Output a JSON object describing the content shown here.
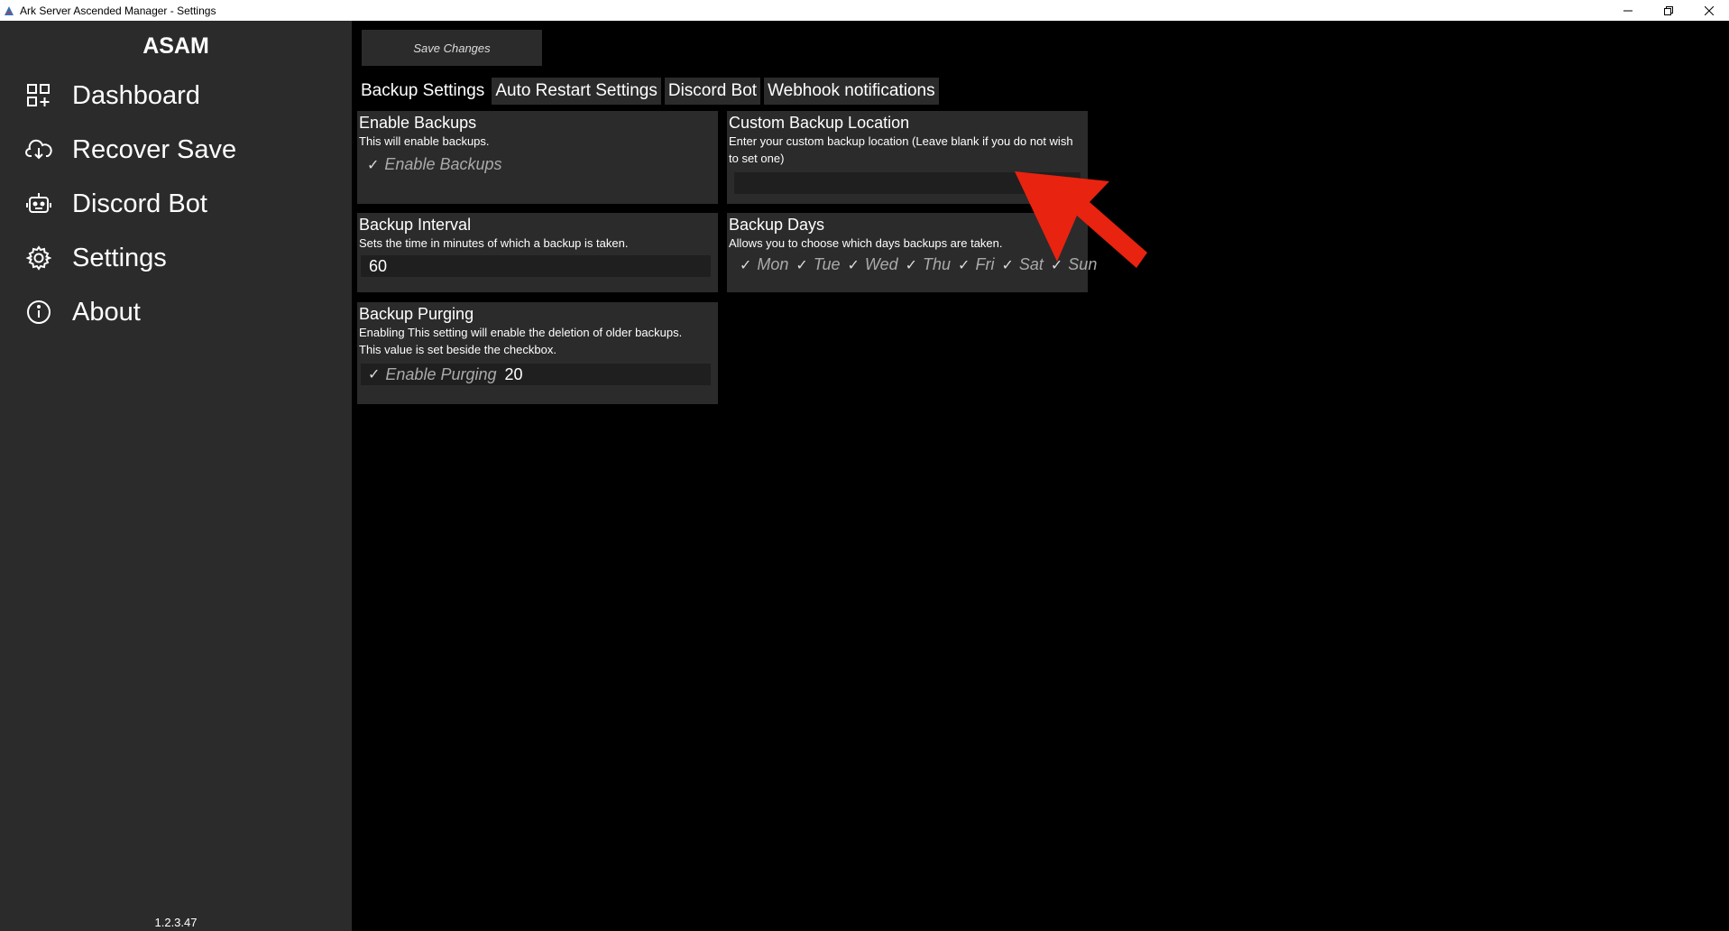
{
  "window": {
    "title": "Ark Server Ascended Manager - Settings",
    "minimize_icon": "minimize-icon",
    "restore_icon": "restore-icon",
    "close_icon": "close-icon"
  },
  "sidebar": {
    "brand": "ASAM",
    "items": [
      {
        "label": "Dashboard",
        "icon": "dashboard-grid-icon"
      },
      {
        "label": "Recover Save",
        "icon": "cloud-download-icon"
      },
      {
        "label": "Discord Bot",
        "icon": "bot-icon"
      },
      {
        "label": "Settings",
        "icon": "gear-icon"
      },
      {
        "label": "About",
        "icon": "info-icon"
      }
    ],
    "version": "1.2.3.47"
  },
  "toolbar": {
    "save_label": "Save Changes"
  },
  "tabs": [
    {
      "label": "Backup Settings",
      "active": true
    },
    {
      "label": "Auto Restart Settings",
      "active": false
    },
    {
      "label": "Discord Bot",
      "active": false
    },
    {
      "label": "Webhook notifications",
      "active": false
    }
  ],
  "cards": {
    "enable_backups": {
      "title": "Enable Backups",
      "desc": "This will enable backups.",
      "checkbox_label": "Enable Backups",
      "checked": true
    },
    "custom_location": {
      "title": "Custom Backup Location",
      "desc": "Enter your custom backup location (Leave blank if you do not wish to set one)",
      "value": ""
    },
    "backup_interval": {
      "title": "Backup Interval",
      "desc": "Sets the time in minutes of which a backup is taken.",
      "value": "60"
    },
    "backup_days": {
      "title": "Backup Days",
      "desc": "Allows you to choose which days backups are taken.",
      "days": [
        "Mon",
        "Tue",
        "Wed",
        "Thu",
        "Fri",
        "Sat",
        "Sun"
      ]
    },
    "backup_purging": {
      "title": "Backup Purging",
      "desc1": "Enabling This setting will enable the deletion of older backups.",
      "desc2": "This value is set beside the checkbox.",
      "checkbox_label": "Enable Purging",
      "value": "20"
    }
  },
  "annotation": {
    "arrow_color": "#e8230f"
  },
  "colors": {
    "sidebar_bg": "#2b2b2b",
    "card_bg": "#2b2b2b",
    "field_bg": "#1f1f1f",
    "main_bg": "#000000"
  }
}
